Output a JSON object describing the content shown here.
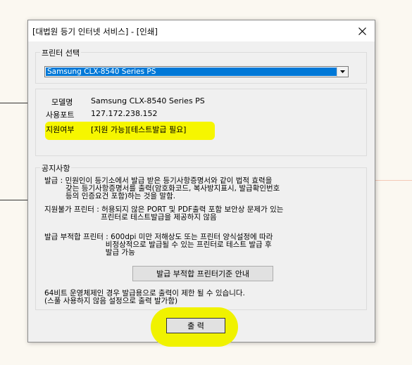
{
  "window": {
    "title": "[대법원 등기 인터넷 서비스] - [인쇄]"
  },
  "printer_select": {
    "legend": "프린터 선택",
    "selected": "Samsung CLX-8540 Series PS"
  },
  "printer_info": {
    "model_label": "모델명",
    "model_value": "Samsung CLX-8540 Series PS",
    "port_label": "사용포트",
    "port_value": "127.172.238.152",
    "support_label": "지원여부",
    "support_value": "[지원 가능][테스트발급 필요]"
  },
  "notice": {
    "legend": "공지사항",
    "lines1": [
      "발급 : 민원인이 등기소에서 발급 받은 등기사항증명서와 같이 법적 효력을",
      "         갖는 등기사항증명서를 출력(암호화코드, 복사방지표시, 발급확인번호",
      "         등의 인증요건 포함)하는 것을 말함."
    ],
    "lines2": [
      "지원불가 프린터 : 허용되지 않은 PORT 및 PDF출력 포함 보안상 문제가 있는",
      "                        프린터로 테스트발급을 제공하지 않음"
    ],
    "lines3": [
      "발급 부적합 프린터 : 600dpi 미만 저해상도 또는 프린터 양식설정에 따라",
      "                          비정상적으로 발급될 수 있는 프린터로 테스트 발급 후",
      "                          발급 가능"
    ],
    "criteria_button": "발급 부적합 프린터기준 안내",
    "lines4": [
      "64비트 운영체제인 경우 발급용으로 출력이 제한 될 수 있습니다.",
      "(스풀 사용하지 않음 설정으로 출력 발가함)"
    ]
  },
  "print_button": "출  력",
  "colors": {
    "highlight": "#f6f600",
    "selection": "#0078d7"
  }
}
